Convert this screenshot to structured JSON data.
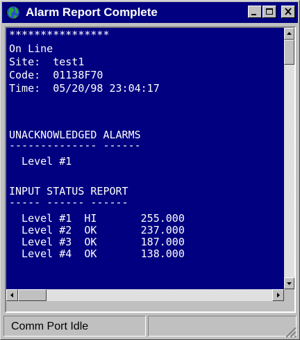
{
  "window": {
    "title": "Alarm Report Complete",
    "icon": "globe-icon",
    "controls": [
      "minimize-icon",
      "maximize-icon",
      "close-icon"
    ]
  },
  "report": {
    "stars": "****************",
    "state": "On Line",
    "site_line": "Site:  test1",
    "code_line": "Code:  01138F70",
    "time_line": "Time:  05/20/98 23:04:17",
    "unack_header": "UNACKNOWLEDGED ALARMS",
    "unack_underline": "-------------- ------",
    "unack_items": [
      "  Level #1"
    ],
    "input_header": "INPUT STATUS REPORT",
    "input_underline": "----- ------ ------",
    "input_rows": [
      "  Level #1  HI       255.000",
      "  Level #2  OK       237.000",
      "  Level #3  OK       187.000",
      "  Level #4  OK       138.000"
    ]
  },
  "scrollbars": {
    "vertical": {
      "position": 0.0
    },
    "horizontal": {
      "position": 0.0
    }
  },
  "statusbar": {
    "pane1": "Comm Port Idle",
    "pane2": ""
  },
  "colors": {
    "titlebar": "#000080",
    "terminal_bg": "#000080",
    "terminal_text": "#ffffff",
    "chrome": "#c0c0c0"
  }
}
